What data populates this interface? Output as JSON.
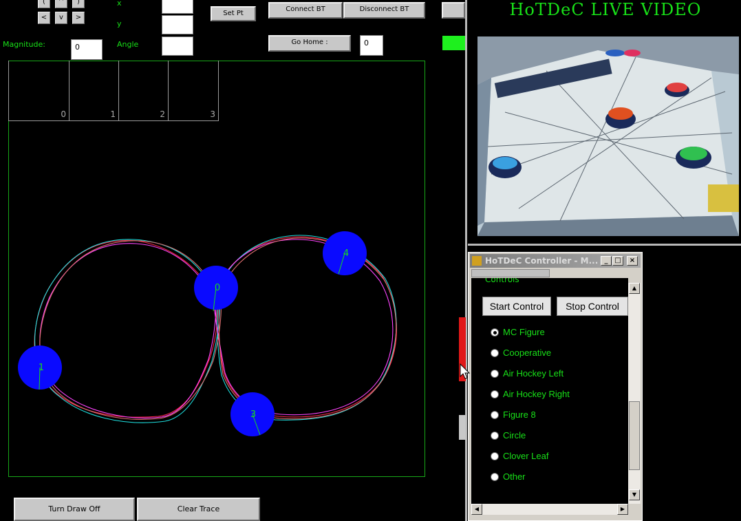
{
  "top_controls": {
    "arrow_buttons": [
      "(",
      "^",
      ")",
      "<",
      "v",
      ">"
    ],
    "x_label": "x",
    "y_label": "y",
    "magnitude_label": "Magnitude:",
    "magnitude_value": "0",
    "angle_label": "Angle",
    "set_pt_label": "Set Pt",
    "connect_bt_label": "Connect BT",
    "disconnect_bt_label": "Disconnect BT",
    "go_home_label": "Go Home :",
    "go_home_value": "0"
  },
  "plot": {
    "slots": [
      "0",
      "1",
      "2",
      "3"
    ],
    "robots": [
      "0",
      "1",
      "3",
      "4"
    ],
    "robot_color": "#0a0aff",
    "trace_colors": [
      "#ff2a4a",
      "#1ee0e0",
      "#ff44ff",
      "#e07070"
    ]
  },
  "bottom_buttons": {
    "turn_draw_off": "Turn Draw Off",
    "clear_trace": "Clear Trace"
  },
  "video": {
    "title": "HoTDeC LIVE VIDEO"
  },
  "controller": {
    "title": "HoTDeC Controller - M...",
    "section": "Controls",
    "start_label": "Start Control",
    "stop_label": "Stop Control",
    "options": [
      "MC Figure",
      "Cooperative",
      "Air Hockey Left",
      "Air Hockey Right",
      "Figure 8",
      "Circle",
      "Clover Leaf",
      "Other"
    ],
    "selected": "MC Figure"
  },
  "accent_green": "#18e018"
}
